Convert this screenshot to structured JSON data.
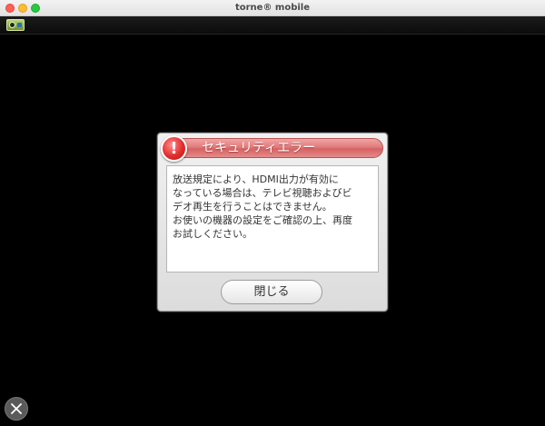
{
  "window": {
    "title": "torne® mobile"
  },
  "toolbar": {
    "app_icon": "torne-app-icon"
  },
  "dialog": {
    "title": "セキュリティエラー",
    "icon": "exclamation-icon",
    "icon_glyph": "!",
    "message_lines": [
      "放送規定により、HDMI出力が有効に",
      "なっている場合は、テレビ視聴およびビ",
      "デオ再生を行うことはできません。",
      "お使いの機器の設定をご確認の上、再度",
      "お試しください。"
    ],
    "close_label": "閉じる"
  },
  "exit_button": {
    "icon": "close-x-icon"
  },
  "colors": {
    "background": "#000000",
    "header_red": "#e27c7c",
    "icon_red": "#e22d2d"
  }
}
